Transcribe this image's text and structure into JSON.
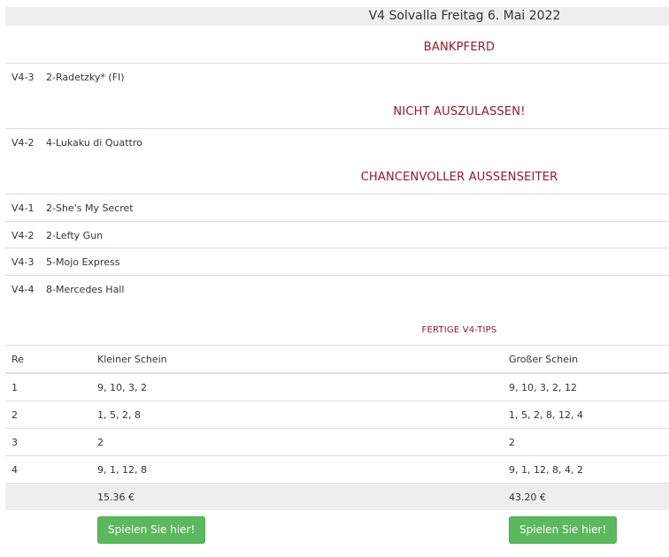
{
  "page": {
    "title": "V4 Solvalla Freitag 6. Mai 2022"
  },
  "sections": {
    "bankpferd": {
      "heading": "BANKPFERD",
      "rows": [
        {
          "code": "V4-3",
          "horse": "2-Radetzky* (FI)"
        }
      ]
    },
    "nicht": {
      "heading": "NICHT AUSZULASSEN!",
      "rows": [
        {
          "code": "V4-2",
          "horse": "4-Lukaku di Quattro"
        }
      ]
    },
    "chancen": {
      "heading": "CHANCENVOLLER AUSSENSEITER",
      "rows": [
        {
          "code": "V4-1",
          "horse": "2-She's My Secret"
        },
        {
          "code": "V4-2",
          "horse": "2-Lefty Gun"
        },
        {
          "code": "V4-3",
          "horse": "5-Mojo Express"
        },
        {
          "code": "V4-4",
          "horse": "8-Mercedes Hall"
        }
      ]
    }
  },
  "tips": {
    "heading": "FERTIGE V4-TIPS",
    "headers": {
      "race": "Re",
      "small": "Kleiner Schein",
      "large": "Großer Schein"
    },
    "rows": [
      {
        "race": "1",
        "small": "9, 10, 3, 2",
        "large": "9, 10, 3, 2, 12"
      },
      {
        "race": "2",
        "small": "1, 5, 2, 8",
        "large": "1, 5, 2, 8, 12, 4"
      },
      {
        "race": "3",
        "small": "2",
        "large": "2"
      },
      {
        "race": "4",
        "small": "9, 1, 12, 8",
        "large": "9, 1, 12, 8, 4, 2"
      }
    ],
    "totals": {
      "small": "15.36 €",
      "large": "43.20 €"
    },
    "button_label": "Spielen Sie hier!"
  },
  "colors": {
    "heading": "#a0142d",
    "button": "#5cb85c",
    "band": "#eeeeee"
  }
}
